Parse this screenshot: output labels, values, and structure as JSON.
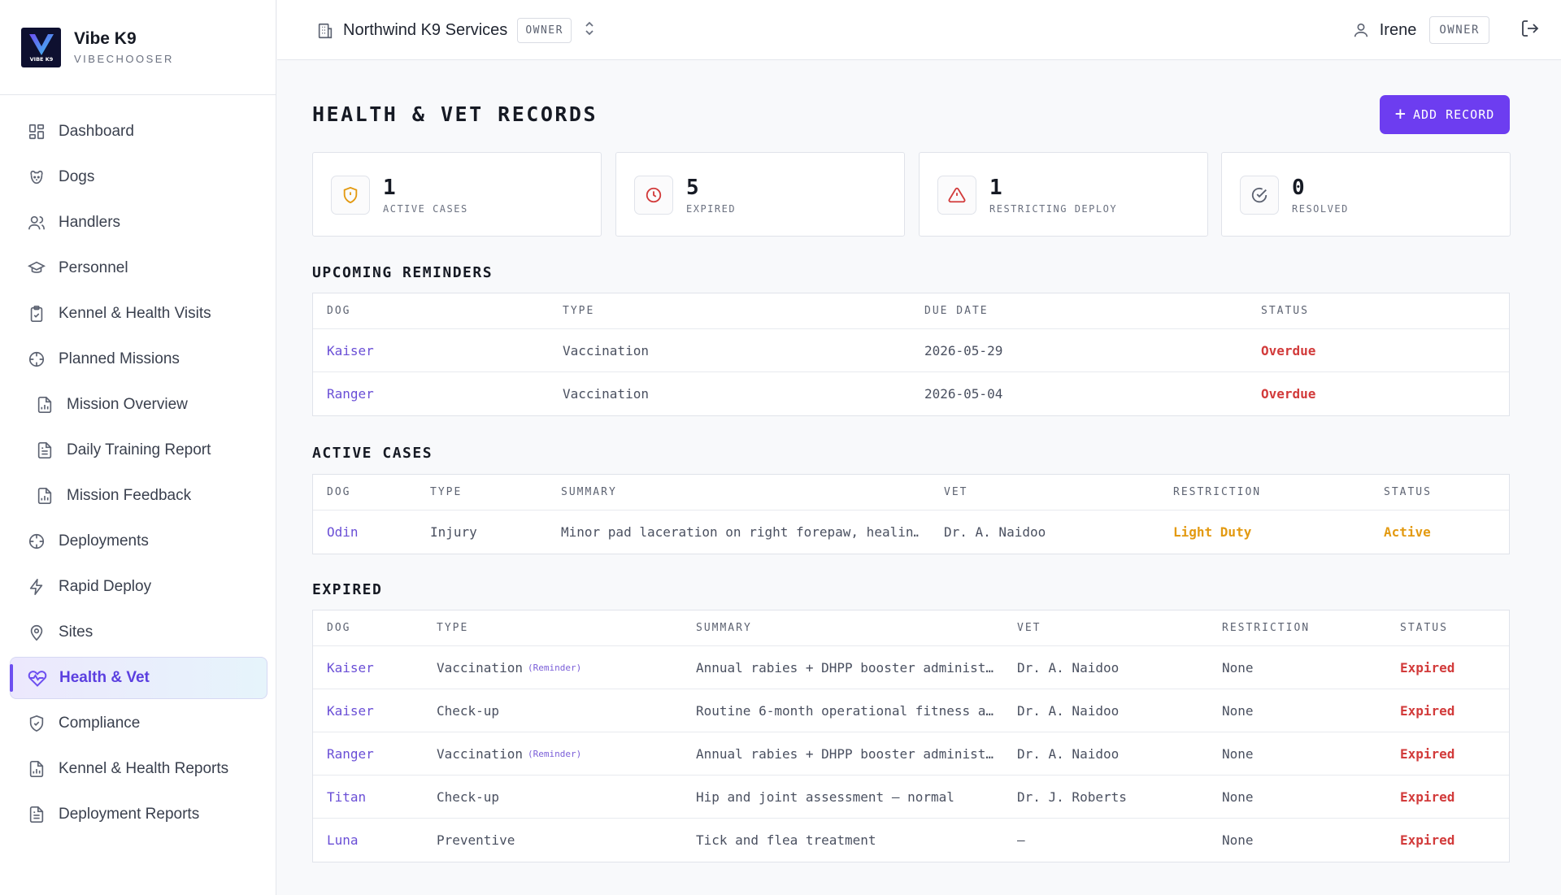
{
  "brand": {
    "name": "Vibe K9",
    "sub": "VIBECHOOSER",
    "logo_text": "VIBE K9"
  },
  "sidebar": {
    "items": [
      {
        "label": "Dashboard",
        "icon": "grid-icon"
      },
      {
        "label": "Dogs",
        "icon": "dog-icon"
      },
      {
        "label": "Handlers",
        "icon": "users-icon"
      },
      {
        "label": "Personnel",
        "icon": "graduation-cap-icon"
      },
      {
        "label": "Kennel & Health Visits",
        "icon": "clipboard-check-icon"
      },
      {
        "label": "Planned Missions",
        "icon": "crosshair-icon"
      },
      {
        "label": "Mission Overview",
        "icon": "file-chart-icon"
      },
      {
        "label": "Daily Training Report",
        "icon": "file-text-icon"
      },
      {
        "label": "Mission Feedback",
        "icon": "file-chart-icon"
      },
      {
        "label": "Deployments",
        "icon": "crosshair-icon"
      },
      {
        "label": "Rapid Deploy",
        "icon": "bolt-icon"
      },
      {
        "label": "Sites",
        "icon": "map-pin-icon"
      },
      {
        "label": "Health & Vet",
        "icon": "heart-pulse-icon",
        "active": true
      },
      {
        "label": "Compliance",
        "icon": "shield-check-icon"
      },
      {
        "label": "Kennel & Health Reports",
        "icon": "file-chart-icon"
      },
      {
        "label": "Deployment Reports",
        "icon": "file-text-icon"
      }
    ]
  },
  "topbar": {
    "org_name": "Northwind K9 Services",
    "org_role": "OWNER",
    "user_name": "Irene",
    "user_role": "OWNER"
  },
  "page": {
    "title": "HEALTH & VET RECORDS",
    "add_label": "ADD RECORD"
  },
  "stats": [
    {
      "value": "1",
      "label": "ACTIVE CASES",
      "icon": "shield-alert-icon",
      "color": "#e39a12"
    },
    {
      "value": "5",
      "label": "EXPIRED",
      "icon": "clock-icon",
      "color": "#d23b3b"
    },
    {
      "value": "1",
      "label": "RESTRICTING DEPLOY",
      "icon": "alert-triangle-icon",
      "color": "#d23b3b"
    },
    {
      "value": "0",
      "label": "RESOLVED",
      "icon": "check-circle-icon",
      "color": "#5d6372"
    }
  ],
  "reminders": {
    "title": "UPCOMING REMINDERS",
    "headers": [
      "DOG",
      "TYPE",
      "DUE DATE",
      "STATUS"
    ],
    "rows": [
      {
        "dog": "Kaiser",
        "type": "Vaccination",
        "due": "2026-05-29",
        "status": "Overdue"
      },
      {
        "dog": "Ranger",
        "type": "Vaccination",
        "due": "2026-05-04",
        "status": "Overdue"
      }
    ]
  },
  "active": {
    "title": "ACTIVE CASES",
    "headers": [
      "DOG",
      "TYPE",
      "SUMMARY",
      "VET",
      "RESTRICTION",
      "STATUS"
    ],
    "rows": [
      {
        "dog": "Odin",
        "type": "Injury",
        "summary": "Minor pad laceration on right forepaw, healin…",
        "vet": "Dr. A. Naidoo",
        "restriction": "Light Duty",
        "status": "Active"
      }
    ]
  },
  "expired": {
    "title": "EXPIRED",
    "headers": [
      "DOG",
      "TYPE",
      "SUMMARY",
      "VET",
      "RESTRICTION",
      "STATUS"
    ],
    "reminder_tag": "(Reminder)",
    "rows": [
      {
        "dog": "Kaiser",
        "type": "Vaccination",
        "reminder": true,
        "summary": "Annual rabies + DHPP booster administ…",
        "vet": "Dr. A. Naidoo",
        "restriction": "None",
        "status": "Expired"
      },
      {
        "dog": "Kaiser",
        "type": "Check-up",
        "reminder": false,
        "summary": "Routine 6-month operational fitness a…",
        "vet": "Dr. A. Naidoo",
        "restriction": "None",
        "status": "Expired"
      },
      {
        "dog": "Ranger",
        "type": "Vaccination",
        "reminder": true,
        "summary": "Annual rabies + DHPP booster administ…",
        "vet": "Dr. A. Naidoo",
        "restriction": "None",
        "status": "Expired"
      },
      {
        "dog": "Titan",
        "type": "Check-up",
        "reminder": false,
        "summary": "Hip and joint assessment — normal",
        "vet": "Dr. J. Roberts",
        "restriction": "None",
        "status": "Expired"
      },
      {
        "dog": "Luna",
        "type": "Preventive",
        "reminder": false,
        "summary": "Tick and flea treatment",
        "vet": "—",
        "restriction": "None",
        "status": "Expired"
      }
    ]
  }
}
